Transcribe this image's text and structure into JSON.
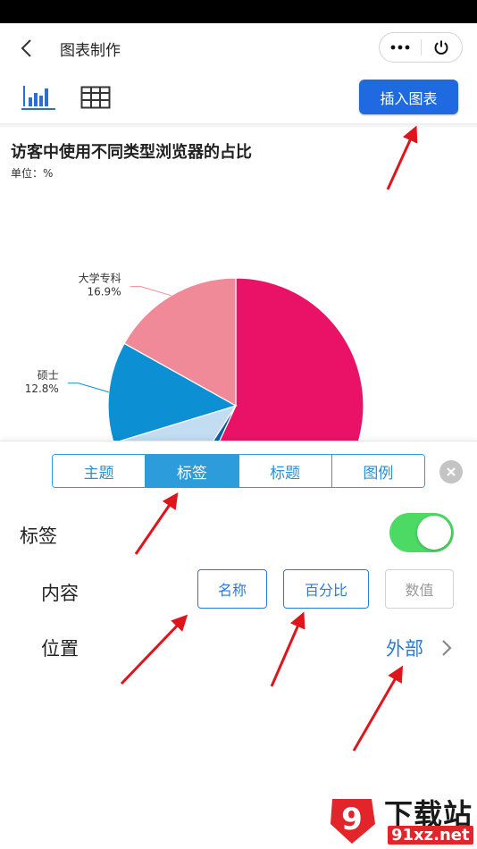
{
  "header": {
    "title": "图表制作"
  },
  "toolbar": {
    "insert_label": "插入图表",
    "accent": "#1f6ae0"
  },
  "chart": {
    "title": "访客中使用不同类型浏览器的占比",
    "unit": "单位：%"
  },
  "chart_data": {
    "type": "pie",
    "title": "访客中使用不同类型浏览器的占比",
    "unit": "单位：%",
    "slices": [
      {
        "name": "",
        "label": "",
        "value": 56.9,
        "color": "#ea1266"
      },
      {
        "name": "",
        "label": "",
        "value": 2.2,
        "color": "#0b5fa5"
      },
      {
        "name": "",
        "label": "",
        "value": 11.2,
        "color": "#c2dcf2"
      },
      {
        "name": "硕士",
        "label": "12.8%",
        "value": 12.8,
        "color": "#0d8fd3"
      },
      {
        "name": "大学专科",
        "label": "16.9%",
        "value": 16.9,
        "color": "#f08a99"
      }
    ]
  },
  "panel": {
    "tabs": [
      {
        "label": "主题",
        "active": false
      },
      {
        "label": "标签",
        "active": true
      },
      {
        "label": "标题",
        "active": false
      },
      {
        "label": "图例",
        "active": false
      }
    ],
    "label_toggle": {
      "label": "标签",
      "on": true
    },
    "content": {
      "label": "内容",
      "options": [
        {
          "label": "名称",
          "enabled": true
        },
        {
          "label": "百分比",
          "enabled": true
        },
        {
          "label": "数值",
          "enabled": false
        }
      ]
    },
    "position": {
      "label": "位置",
      "value": "外部"
    },
    "accent": "#2d9cdb",
    "toggle_color": "#4cd964"
  },
  "watermark": {
    "badge": "9",
    "text": "下载站",
    "url": "91xz.net"
  },
  "annotation_color": "#e0141b"
}
